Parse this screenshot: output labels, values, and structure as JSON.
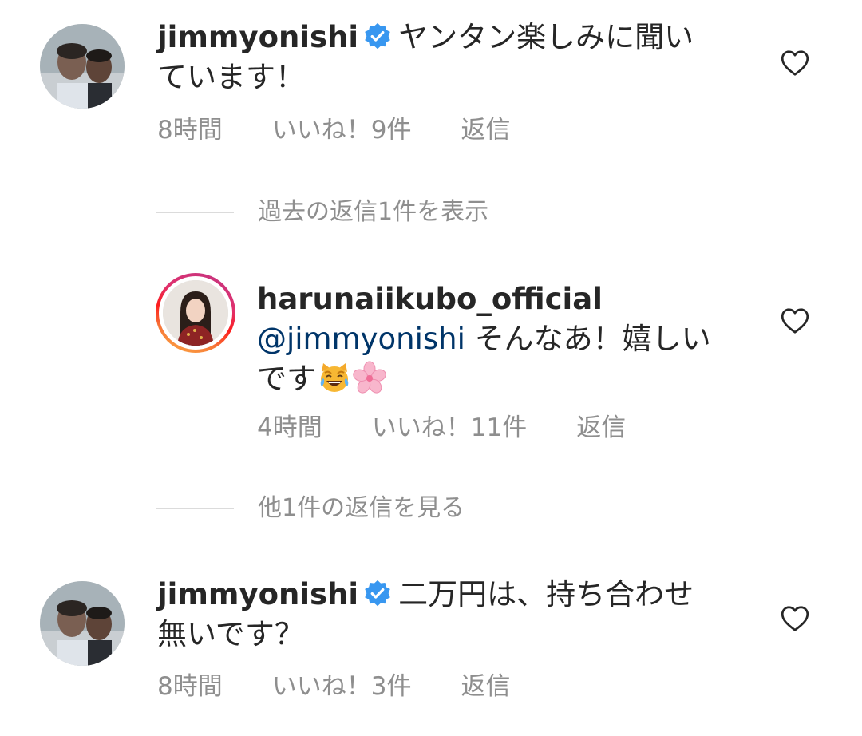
{
  "comments": [
    {
      "username": "jimmyonishi",
      "verified": true,
      "text": "ヤンタン楽しみに聞いています！",
      "text_line1": "ヤンタン楽しみに聞い",
      "text_line2": "ています！",
      "time": "8時間",
      "likes": "いいね！9件",
      "reply": "返信",
      "avatar_icon": "user-photo-icon",
      "like_icon": "heart-outline-icon"
    },
    {
      "username": "harunaiikubo_official",
      "verified": false,
      "mention": "@jimmyonishi",
      "text_line1": "そんなあ！嬉しい",
      "text_line2": "です",
      "emojis": [
        "grinning-cat-with-tears-of-joy-emoji",
        "cherry-blossom-emoji"
      ],
      "time": "4時間",
      "likes": "いいね！11件",
      "reply": "返信",
      "avatar_icon": "user-photo-icon",
      "like_icon": "heart-outline-icon",
      "story_ring": true
    },
    {
      "username": "jimmyonishi",
      "verified": true,
      "text_line1": "二万円は、持ち合わせ",
      "text_line2": "無いです？",
      "time": "8時間",
      "likes": "いいね！3件",
      "reply": "返信",
      "avatar_icon": "user-photo-icon",
      "like_icon": "heart-outline-icon"
    }
  ],
  "threads": {
    "previous_replies": "過去の返信1件を表示",
    "more_replies": "他1件の返信を見る"
  },
  "colors": {
    "text": "#262626",
    "meta": "#8e8e8e",
    "mention": "#003569",
    "verified": "#3897f0",
    "divider": "#dbdbdb"
  }
}
